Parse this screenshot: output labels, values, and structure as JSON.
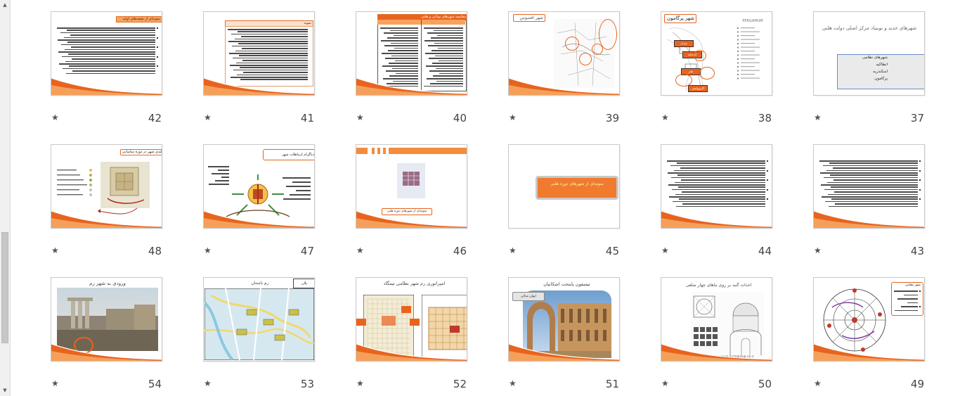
{
  "slides_row1": [
    {
      "number": "42",
      "kind": "text-dense",
      "title": "نمونه‌ای از نقشه‌های اولیه"
    },
    {
      "number": "41",
      "kind": "table-text",
      "title": "نمونه"
    },
    {
      "number": "40",
      "kind": "table",
      "title": "مقایسه شهرهای یونانی و هلنی"
    },
    {
      "number": "39",
      "kind": "map",
      "title": "شهر افسوس"
    },
    {
      "number": "38",
      "kind": "map-labels",
      "title": "شهر پرگامون",
      "map_caption": "PERGAMUM",
      "labels": [
        "میدان",
        "کتابخانه",
        "تئاتر",
        "آکروپولیس"
      ]
    },
    {
      "number": "37",
      "kind": "title-list",
      "title": "شهرهای جدید و نوبنیاد مرکز اصلی دولت هلنی",
      "list": [
        "شهرهای نظامی",
        "انطاکیه",
        "اسکندریه",
        "پرگامون"
      ]
    }
  ],
  "slides_row2": [
    {
      "number": "48",
      "kind": "map-legend",
      "title": "ساختار کالبدی شهر در دوره ساسانی"
    },
    {
      "number": "47",
      "kind": "diagram",
      "title": "دیاگرام ارتباطات شهر"
    },
    {
      "number": "46",
      "kind": "image-note",
      "title": "",
      "caption": "نمونه‌ای از شهرهای دوره هلنی"
    },
    {
      "number": "45",
      "kind": "callout",
      "title": "",
      "callout": "نمونه‌ای از شهرهای دوره هلنی"
    },
    {
      "number": "44",
      "kind": "text-dense",
      "title": ""
    },
    {
      "number": "43",
      "kind": "text-dense",
      "title": ""
    }
  ],
  "slides_row3": [
    {
      "number": "54",
      "kind": "photo",
      "title": "ورودی به شهر رم"
    },
    {
      "number": "53",
      "kind": "city-map",
      "title": "رم باستان",
      "tag": "پلان"
    },
    {
      "number": "52",
      "kind": "two-plans",
      "title": "امپراتوری رم شهر نظامی تیمگاد"
    },
    {
      "number": "51",
      "kind": "photo-arch",
      "title": "تیسفون پایتخت اشکانیان",
      "badge": "ایوان مدائن"
    },
    {
      "number": "50",
      "kind": "drawing",
      "title": "احداث گنبد بر روی بناهای چهار ضلعی",
      "watermark": "www.archigroup.co.ir"
    },
    {
      "number": "49",
      "kind": "circle-diagram",
      "title": "",
      "legend_title": "شهر نظامی"
    }
  ],
  "ui": {
    "star_glyph": "★",
    "scroll_up": "▲",
    "scroll_down": "▼"
  },
  "colors": {
    "accent": "#e8641e",
    "accent_light": "#f7a35c",
    "selection_border": "#c8c8c8"
  }
}
